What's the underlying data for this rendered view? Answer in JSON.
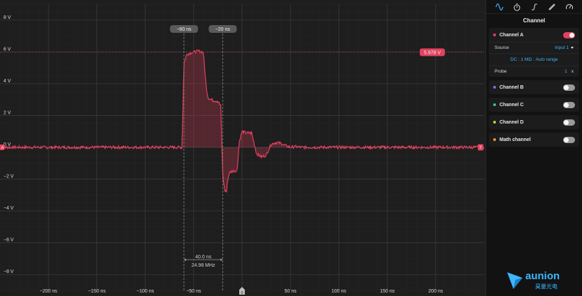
{
  "scope": {
    "y_axis": {
      "unit": "V",
      "min": -9,
      "max": 9,
      "ticks": [
        8,
        6,
        4,
        2,
        0,
        -2,
        -4,
        -6,
        -8
      ],
      "labels": [
        "8 V",
        "6 V",
        "4 V",
        "2 V",
        "0 V",
        "−2 V",
        "−4 V",
        "−6 V",
        "−8 V"
      ]
    },
    "x_axis": {
      "unit": "ns",
      "min": -250,
      "max": 250,
      "ticks": [
        -200,
        -150,
        -100,
        -50,
        50,
        100,
        150,
        200
      ],
      "labels": [
        "−200 ns",
        "−150 ns",
        "−100 ns",
        "−50 ns",
        "50 ns",
        "100 ns",
        "150 ns",
        "200 ns"
      ]
    },
    "cursor1": {
      "x": -60,
      "label": "−60 ns"
    },
    "cursor2": {
      "x": -20,
      "label": "−20 ns"
    },
    "cursor_delta": "40.0 ns",
    "cursor_freq": "24.98 MHz",
    "level": {
      "y": 5.978,
      "label": "5.978 V"
    },
    "channel_marker": "A",
    "trigger_marker": "T",
    "zero_marker": "0",
    "colors": {
      "trace": "#e2415f",
      "fill": "#e2415f",
      "grid": "#2c2c2c",
      "cursor": "#8a8a8a",
      "accent": "#3db6ff"
    }
  },
  "chart_data": {
    "type": "line",
    "xlabel": "",
    "ylabel": "",
    "xlim": [
      -250,
      250
    ],
    "ylim": [
      -9,
      9
    ],
    "grid": true,
    "series": [
      {
        "x": [
          -250,
          -62,
          -60,
          -57,
          -50,
          -45,
          -40,
          -37,
          -35,
          -30,
          -25,
          -22,
          -20,
          -18,
          -16,
          -15,
          -13,
          -10,
          -5,
          -3,
          0,
          2,
          5,
          10,
          15,
          20,
          25,
          30,
          35,
          40,
          45,
          50,
          55,
          60,
          70,
          80,
          250
        ],
        "y": [
          0,
          0,
          5.3,
          5.85,
          6.0,
          6.05,
          5.98,
          3.8,
          3.1,
          2.95,
          2.9,
          2.6,
          -1.7,
          -2.7,
          -2.8,
          -2.1,
          -1.6,
          -1.5,
          -1.45,
          0.3,
          1.0,
          0.95,
          0.9,
          0.9,
          -0.4,
          -0.6,
          -0.5,
          0.2,
          0.3,
          0.25,
          0.1,
          0.0,
          0.05,
          0.0,
          0.0,
          0.0,
          0.0
        ]
      }
    ]
  },
  "panel": {
    "title": "Channel",
    "tabs": [
      "channel-tab",
      "timebase-tab",
      "trigger-tab",
      "measure-tab",
      "gauge-tab"
    ],
    "channels": [
      {
        "name": "Channel A",
        "color": "#e2415f",
        "on": true
      },
      {
        "name": "Channel B",
        "color": "#7c6cf0",
        "on": false
      },
      {
        "name": "Channel C",
        "color": "#33c48a",
        "on": false
      },
      {
        "name": "Channel D",
        "color": "#c8c83a",
        "on": false
      },
      {
        "name": "Math channel",
        "color": "#f0903a",
        "on": false
      }
    ],
    "source_label": "Source",
    "source_value": "Input 1",
    "coupling": "DC : 1 MΩ : Auto range",
    "probe_label": "Probe",
    "probe_value": "1",
    "probe_unit": "x"
  },
  "logo": {
    "brand": "aunion",
    "sub": "昊量光电",
    "color": "#3db6ff"
  }
}
